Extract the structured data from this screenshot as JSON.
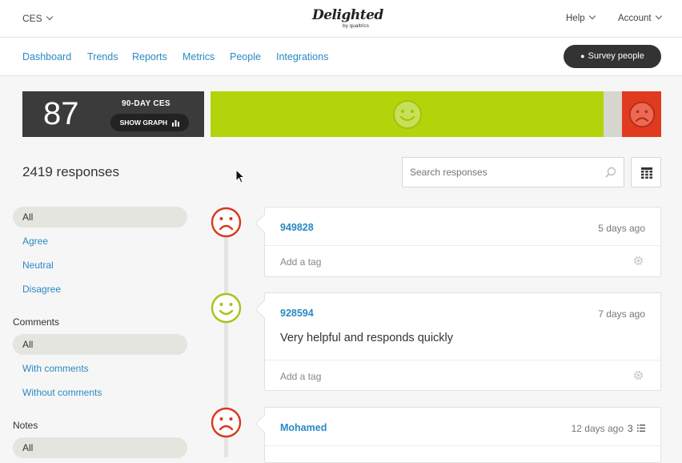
{
  "header": {
    "survey_label": "CES",
    "logo_text": "Delighted",
    "logo_sub": "by qualtrics",
    "help_label": "Help",
    "account_label": "Account"
  },
  "nav": {
    "items": [
      "Dashboard",
      "Trends",
      "Reports",
      "Metrics",
      "People",
      "Integrations"
    ],
    "survey_button": "Survey people"
  },
  "score": {
    "value": "87",
    "label": "90-DAY CES",
    "graph_button": "SHOW GRAPH"
  },
  "distribution": {
    "agree_fraction": 0.872,
    "neutral_fraction": 0.04,
    "disagree_fraction": 0.088,
    "colors": {
      "agree": "#b3d30b",
      "neutral": "#d7d7cf",
      "disagree": "#e03a1f"
    }
  },
  "responses": {
    "count_label": "2419 responses",
    "search_placeholder": "Search responses"
  },
  "filters": {
    "score_items": [
      "All",
      "Agree",
      "Neutral",
      "Disagree"
    ],
    "comments_heading": "Comments",
    "comments_items": [
      "All",
      "With comments",
      "Without comments"
    ],
    "notes_heading": "Notes",
    "notes_items": [
      "All"
    ]
  },
  "cards": [
    {
      "name": "949828",
      "time": "5 days ago",
      "comment": "",
      "tag_placeholder": "Add a tag",
      "sentiment": "disagree"
    },
    {
      "name": "928594",
      "time": "7 days ago",
      "comment": "Very helpful and responds quickly",
      "tag_placeholder": "Add a tag",
      "sentiment": "agree"
    },
    {
      "name": "Mohamed",
      "time": "12 days ago",
      "notes": "3",
      "sentiment": "disagree"
    }
  ]
}
